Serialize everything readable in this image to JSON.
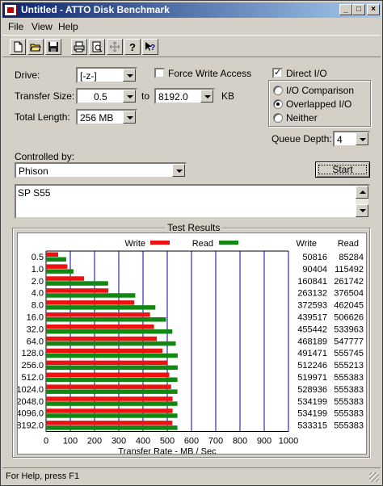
{
  "window": {
    "title": "Untitled - ATTO Disk Benchmark",
    "buttons": {
      "minimize": "_",
      "maximize": "□",
      "close": "×"
    }
  },
  "menu": [
    {
      "label": "File"
    },
    {
      "label": "View"
    },
    {
      "label": "Help"
    }
  ],
  "toolbar": {
    "icons": [
      "new-file-icon",
      "open-folder-icon",
      "save-disk-icon",
      "print-icon",
      "print-preview-icon",
      "move-cross-icon",
      "help-question-icon",
      "context-help-icon"
    ]
  },
  "form": {
    "drive_label": "Drive:",
    "drive_value": "[-z-]",
    "force_write_label": "Force Write Access",
    "force_write_checked": false,
    "direct_io_label": "Direct I/O",
    "direct_io_checked": true,
    "transfer_size_label": "Transfer Size:",
    "transfer_from": "0.5",
    "to_label": "to",
    "transfer_to": "8192.0",
    "kb_label": "KB",
    "total_length_label": "Total Length:",
    "total_length_value": "256 MB",
    "io_comparison_label": "I/O Comparison",
    "overlapped_io_label": "Overlapped I/O",
    "neither_label": "Neither",
    "selected_mode": "Overlapped I/O",
    "queue_depth_label": "Queue Depth:",
    "queue_depth_value": "4",
    "controlled_by_label": "Controlled by:",
    "controlled_by_value": "Phison",
    "start_label": "Start",
    "description": "SP S55"
  },
  "results": {
    "title": "Test Results",
    "legend_write": "Write",
    "legend_read": "Read",
    "col_write": "Write",
    "col_read": "Read",
    "colors": {
      "write": "#ee1111",
      "read": "#118811",
      "grid": "#0000aa"
    }
  },
  "chart_data": {
    "type": "bar",
    "orientation": "horizontal",
    "title": "Test Results",
    "xlabel": "Transfer Rate - MB / Sec",
    "xlim": [
      0,
      1000
    ],
    "xticks": [
      0,
      100,
      200,
      300,
      400,
      500,
      600,
      700,
      800,
      900,
      1000
    ],
    "categories": [
      "0.5",
      "1.0",
      "2.0",
      "4.0",
      "8.0",
      "16.0",
      "32.0",
      "64.0",
      "128.0",
      "256.0",
      "512.0",
      "1024.0",
      "2048.0",
      "4096.0",
      "8192.0"
    ],
    "series": [
      {
        "name": "Write",
        "values": [
          50,
          88,
          157,
          257,
          364,
          429,
          445,
          457,
          480,
          500,
          508,
          516,
          522,
          522,
          521
        ]
      },
      {
        "name": "Read",
        "values": [
          83,
          113,
          256,
          368,
          451,
          495,
          521,
          535,
          543,
          543,
          542,
          542,
          542,
          542,
          542
        ]
      }
    ],
    "write_numbers": [
      "50816",
      "90404",
      "160841",
      "263132",
      "372593",
      "439517",
      "455442",
      "468189",
      "491471",
      "512246",
      "519971",
      "528936",
      "534199",
      "534199",
      "533315"
    ],
    "read_numbers": [
      "85284",
      "115492",
      "261742",
      "376504",
      "462045",
      "506626",
      "533963",
      "547777",
      "555745",
      "555213",
      "555383",
      "555383",
      "555383",
      "555383",
      "555383"
    ]
  },
  "status": {
    "text": "For Help, press F1"
  }
}
